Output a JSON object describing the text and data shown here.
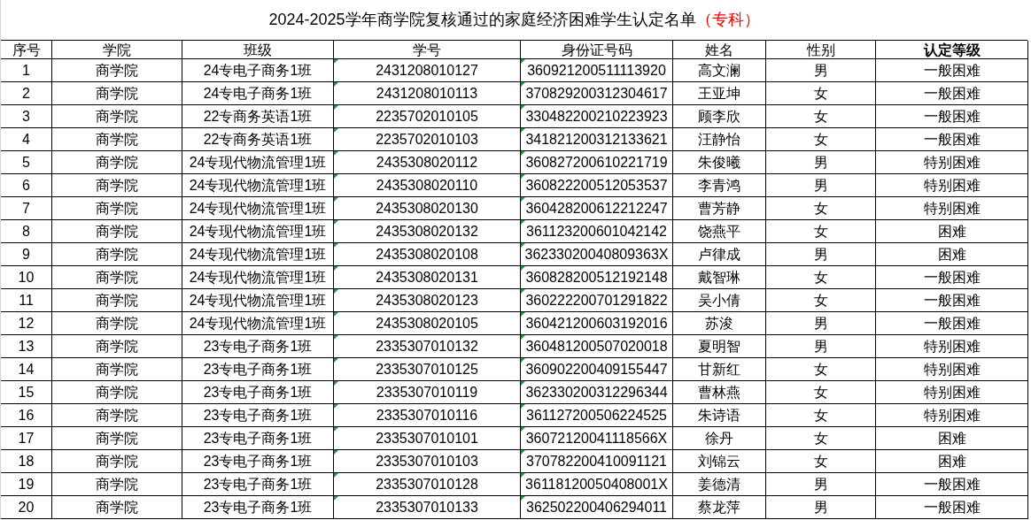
{
  "title": "2024-2025学年商学院复核通过的家庭经济困难学生认定名单",
  "title_suffix": "（专科）",
  "columns": [
    {
      "label": "序号",
      "bold": false,
      "flagged": false
    },
    {
      "label": "学院",
      "bold": false,
      "flagged": false
    },
    {
      "label": "班级",
      "bold": false,
      "flagged": false
    },
    {
      "label": "学号",
      "bold": false,
      "flagged": true
    },
    {
      "label": "身份证号码",
      "bold": false,
      "flagged": true
    },
    {
      "label": "姓名",
      "bold": false,
      "flagged": false
    },
    {
      "label": "性别",
      "bold": false,
      "flagged": false
    },
    {
      "label": "认定等级",
      "bold": true,
      "flagged": false
    }
  ],
  "rows": [
    [
      "1",
      "商学院",
      "24专电子商务1班",
      "2431208010127",
      "360921200511113920",
      "高文澜",
      "男",
      "一般困难"
    ],
    [
      "2",
      "商学院",
      "24专电子商务1班",
      "2431208010113",
      "370829200312304617",
      "王亚坤",
      "女",
      "一般困难"
    ],
    [
      "3",
      "商学院",
      "22专商务英语1班",
      "2235702010105",
      "330482200210223923",
      "顾李欣",
      "女",
      "一般困难"
    ],
    [
      "4",
      "商学院",
      "22专商务英语1班",
      "2235702010103",
      "341821200312133621",
      "汪静怡",
      "女",
      "一般困难"
    ],
    [
      "5",
      "商学院",
      "24专现代物流管理1班",
      "2435308020112",
      "360827200610221719",
      "朱俊曦",
      "男",
      "特别困难"
    ],
    [
      "6",
      "商学院",
      "24专现代物流管理1班",
      "2435308020110",
      "360822200512053537",
      "李青鸿",
      "男",
      "特别困难"
    ],
    [
      "7",
      "商学院",
      "24专现代物流管理1班",
      "2435308020130",
      "360428200612212247",
      "曹芳静",
      "女",
      "特别困难"
    ],
    [
      "8",
      "商学院",
      "24专现代物流管理1班",
      "2435308020132",
      "361123200601042142",
      "饶燕平",
      "女",
      "困难"
    ],
    [
      "9",
      "商学院",
      "24专现代物流管理1班",
      "2435308020108",
      "36233020040809363X",
      "卢律成",
      "男",
      "困难"
    ],
    [
      "10",
      "商学院",
      "24专现代物流管理1班",
      "2435308020131",
      "360828200512192148",
      "戴智琳",
      "女",
      "一般困难"
    ],
    [
      "11",
      "商学院",
      "24专现代物流管理1班",
      "2435308020123",
      "360222200701291822",
      "吴小倩",
      "女",
      "一般困难"
    ],
    [
      "12",
      "商学院",
      "24专现代物流管理1班",
      "2435308020105",
      "360421200603192016",
      "苏浚",
      "男",
      "一般困难"
    ],
    [
      "13",
      "商学院",
      "23专电子商务1班",
      "2335307010132",
      "360481200507020018",
      "夏明智",
      "男",
      "特别困难"
    ],
    [
      "14",
      "商学院",
      "23专电子商务1班",
      "2335307010125",
      "360902200409155447",
      "甘新红",
      "女",
      "特别困难"
    ],
    [
      "15",
      "商学院",
      "23专电子商务1班",
      "2335307010119",
      "362330200312296344",
      "曹林燕",
      "女",
      "特别困难"
    ],
    [
      "16",
      "商学院",
      "23专电子商务1班",
      "2335307010116",
      "361127200506224525",
      "朱诗语",
      "女",
      "特别困难"
    ],
    [
      "17",
      "商学院",
      "23专电子商务1班",
      "2335307010101",
      "36072120041118566X",
      "徐丹",
      "女",
      "困难"
    ],
    [
      "18",
      "商学院",
      "23专电子商务1班",
      "2335307010103",
      "370782200410091121",
      "刘锦云",
      "女",
      "困难"
    ],
    [
      "19",
      "商学院",
      "23专电子商务1班",
      "2335307010128",
      "36118120050408001X",
      "姜德清",
      "男",
      "一般困难"
    ],
    [
      "20",
      "商学院",
      "23专电子商务1班",
      "2335307010133",
      "362502200406294011",
      "蔡龙萍",
      "男",
      "一般困难"
    ]
  ]
}
